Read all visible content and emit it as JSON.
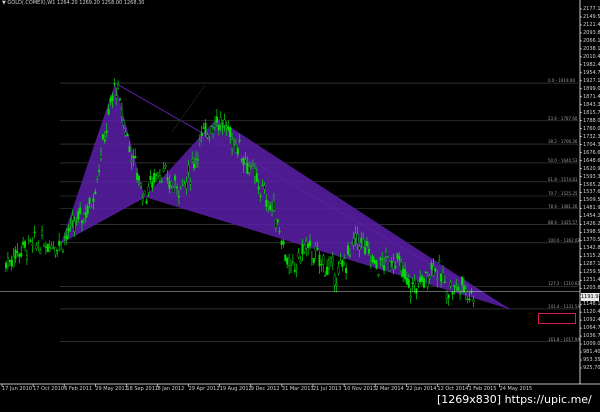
{
  "header": {
    "symbol_line": "▼ GOLD(.COMEX),W1  1264.20 1269.20 1258.00 1268.30"
  },
  "current_price": "1191.93",
  "y_axis_labels": [
    "2177.15",
    "2149.50",
    "2121.45",
    "2093.80",
    "2066.15",
    "2038.10",
    "2010.45",
    "1982.40",
    "1954.75",
    "1927.10",
    "1899.05",
    "1871.40",
    "1843.35",
    "1815.70",
    "1788.05",
    "1760.00",
    "1732.35",
    "1704.30",
    "1676.65",
    "1648.60",
    "1620.95",
    "1593.30",
    "1565.25",
    "1537.60",
    "1509.55",
    "1481.90",
    "1454.25",
    "1426.20",
    "1398.55",
    "1370.50",
    "1342.85",
    "1315.20",
    "1287.15",
    "1259.50",
    "1231.45",
    "1203.80",
    "1175.75",
    "1148.10",
    "1120.45",
    "1092.40",
    "1064.75",
    "1036.70",
    "1009.05",
    "981.40",
    "953.35",
    "925.70"
  ],
  "x_axis_labels": [
    "17 Jun 2010",
    "17 Oct 2010",
    "6 Feb 2011",
    "29 May 2011",
    "18 Sep 2011",
    "8 Jan 2012",
    "29 Apr 2012",
    "19 Aug 2012",
    "9 Dec 2012",
    "31 Mar 2013",
    "21 Jul 2013",
    "10 Nov 2013",
    "2 Mar 2014",
    "22 Jun 2014",
    "12 Oct 2014",
    "1 Feb 2015",
    "24 May 2015"
  ],
  "fib_levels": [
    {
      "label": "0.0 - 1919.00",
      "price": 1919.0
    },
    {
      "label": "23.6 - 1787.60",
      "price": 1787.6
    },
    {
      "label": "38.2 - 1706.26",
      "price": 1706.26
    },
    {
      "label": "50.0 - 1640.53",
      "price": 1640.53
    },
    {
      "label": "61.8 - 1574.81",
      "price": 1574.81
    },
    {
      "label": "70.7 - 1525.25",
      "price": 1525.25
    },
    {
      "label": "78.6 - 1481.26",
      "price": 1481.26
    },
    {
      "label": "88.6 - 1425.57",
      "price": 1425.57
    },
    {
      "label": "100.0 - 1362.08",
      "price": 1362.08
    },
    {
      "label": "127.2 - 1210.62",
      "price": 1210.62
    },
    {
      "label": "141.4 - 1131.54",
      "price": 1131.54
    },
    {
      "label": "161.8 - 1017.94",
      "price": 1017.94
    }
  ],
  "highlighted_level": "141.4 - 1131.54",
  "pattern": {
    "color": "#5a1fa8",
    "X": {
      "bar": 58,
      "price": 1362
    },
    "A": {
      "bar": 115,
      "price": 1919
    },
    "B": {
      "bar": 146,
      "price": 1522
    },
    "C": {
      "bar": 222,
      "price": 1796
    },
    "D": {
      "bar": 530,
      "price": 1131
    }
  },
  "colors": {
    "bull": "#00e000",
    "bear": "#ffffff",
    "grid": "#555555",
    "price_line": "#c8c8c8"
  },
  "watermark": "[1269x830] https://upic.me/"
}
